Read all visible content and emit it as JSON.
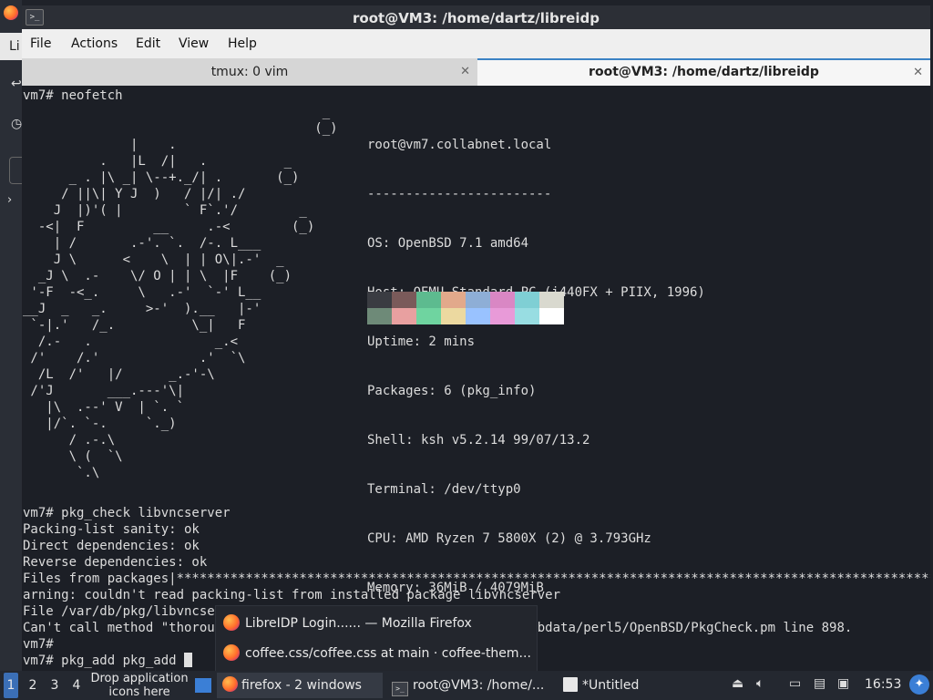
{
  "window": {
    "title": "root@VM3: /home/dartz/libreidp",
    "close_glyph": "✕"
  },
  "menubar": [
    "File",
    "Actions",
    "Edit",
    "View",
    "Help"
  ],
  "tabs": [
    {
      "label": "tmux: 0 vim",
      "close": "✕"
    },
    {
      "label": "root@VM3: /home/dartz/libreidp",
      "close": "✕"
    }
  ],
  "terminal": {
    "first_cmd": "vm7# neofetch",
    "ascii_logo": "                                       _\n                                      (_)\n              |    .\n          .   |L  /|   .          _\n      _ . |\\ _| \\--+._/| .       (_)\n     / ||\\| Y J  )   / |/| ./\n    J  |)'( |        ` F`.'/        _\n  -<|  F         __     .-<        (_)\n    | /       .-'. `.  /-. L___\n    J \\      <    \\  | | O\\|.-'  _\n  _J \\  .-    \\/ O | | \\  |F    (_)\n '-F  -<_.     \\   .-'  `-' L__\n__J  _   _.     >-'  ).__   |-'\n `-|.'   /_.          \\_|   F\n  /.-   .                _.<\n /'    /.'             .'  `\\\n  /L  /'   |/      _.-'-\\\n /'J       ___.---'\\|\n   |\\  .--' V  | `. `\n   |/`. `-.     `._)\n      / .-.\\\n      \\ (  `\\\n       `.\\",
    "info": {
      "userhost": "root@vm7.collabnet.local",
      "separator": "------------------------",
      "lines": [
        "OS: OpenBSD 7.1 amd64",
        "Host: QEMU Standard PC (i440FX + PIIX, 1996)",
        "Uptime: 2 mins",
        "Packages: 6 (pkg_info)",
        "Shell: ksh v5.2.14 99/07/13.2",
        "Terminal: /dev/ttyp0",
        "CPU: AMD Ryzen 7 5800X (2) @ 3.793GHz",
        "Memory: 36MiB / 4079MiB"
      ]
    },
    "palette": [
      "#3a3c42",
      "#7a5a5a",
      "#5dbb8f",
      "#e2a98b",
      "#8eaed6",
      "#d987c4",
      "#7fcfd4",
      "#d9d9cf",
      "#6e8a78",
      "#e8a0a0",
      "#6fd4a0",
      "#ecd9a0",
      "#99c2ff",
      "#e89ad8",
      "#98dde2",
      "#ffffff"
    ],
    "output_lines": [
      "vm7# pkg_check libvncserver",
      "Packing-list sanity: ok",
      "Direct dependencies: ok",
      "Reverse dependencies: ok",
      "Files from packages|*******************************************************************************************************",
      "arning: couldn't read packing-list from installed package libvncserver",
      "File /var/db/pkg/libvncserver/+CONTENTS does not exist",
      "Can't call method \"thorough_check\" on an undefined value at /usr/libdata/perl5/OpenBSD/PkgCheck.pm line 898.",
      "vm7#"
    ],
    "prompt_line": "vm7# pkg_add pkg_add "
  },
  "popup": [
    {
      "label": "LibreIDP Login...... — Mozilla Firefox"
    },
    {
      "label": "coffee.css/coffee.css at main · coffee-them..."
    }
  ],
  "taskbar": {
    "workspaces": [
      "1",
      "2",
      "3",
      "4"
    ],
    "drop_hint": "Drop application icons here",
    "tasks": [
      {
        "label": "firefox - 2 windows"
      },
      {
        "label": "root@VM3: /home/..."
      },
      {
        "label": "*Untitled"
      }
    ],
    "clock": "16:53"
  }
}
